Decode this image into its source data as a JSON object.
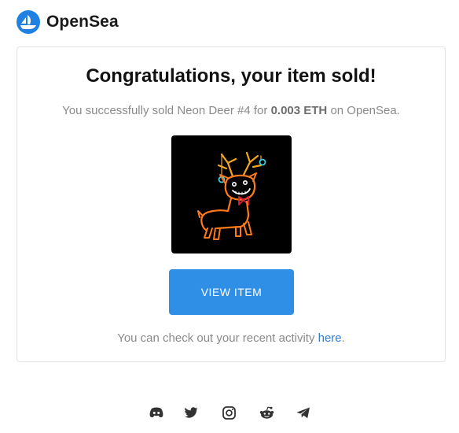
{
  "brand": {
    "name": "OpenSea",
    "color": "#2081e2"
  },
  "card": {
    "title": "Congratulations, your item sold!",
    "message": {
      "prefix": "You successfully sold Neon Deer #4 for ",
      "price": "0.003 ETH",
      "suffix": " on OpenSea."
    },
    "item_image": "neon-deer-image",
    "button_label": "VIEW ITEM",
    "activity": {
      "prefix": "You can check out your recent activity ",
      "link": "here",
      "suffix": "."
    }
  },
  "socials": [
    "discord-icon",
    "twitter-icon",
    "instagram-icon",
    "reddit-icon",
    "telegram-icon"
  ],
  "colors": {
    "button": "#2f8ee6",
    "link": "#2f7fd4",
    "icon": "#333333"
  }
}
